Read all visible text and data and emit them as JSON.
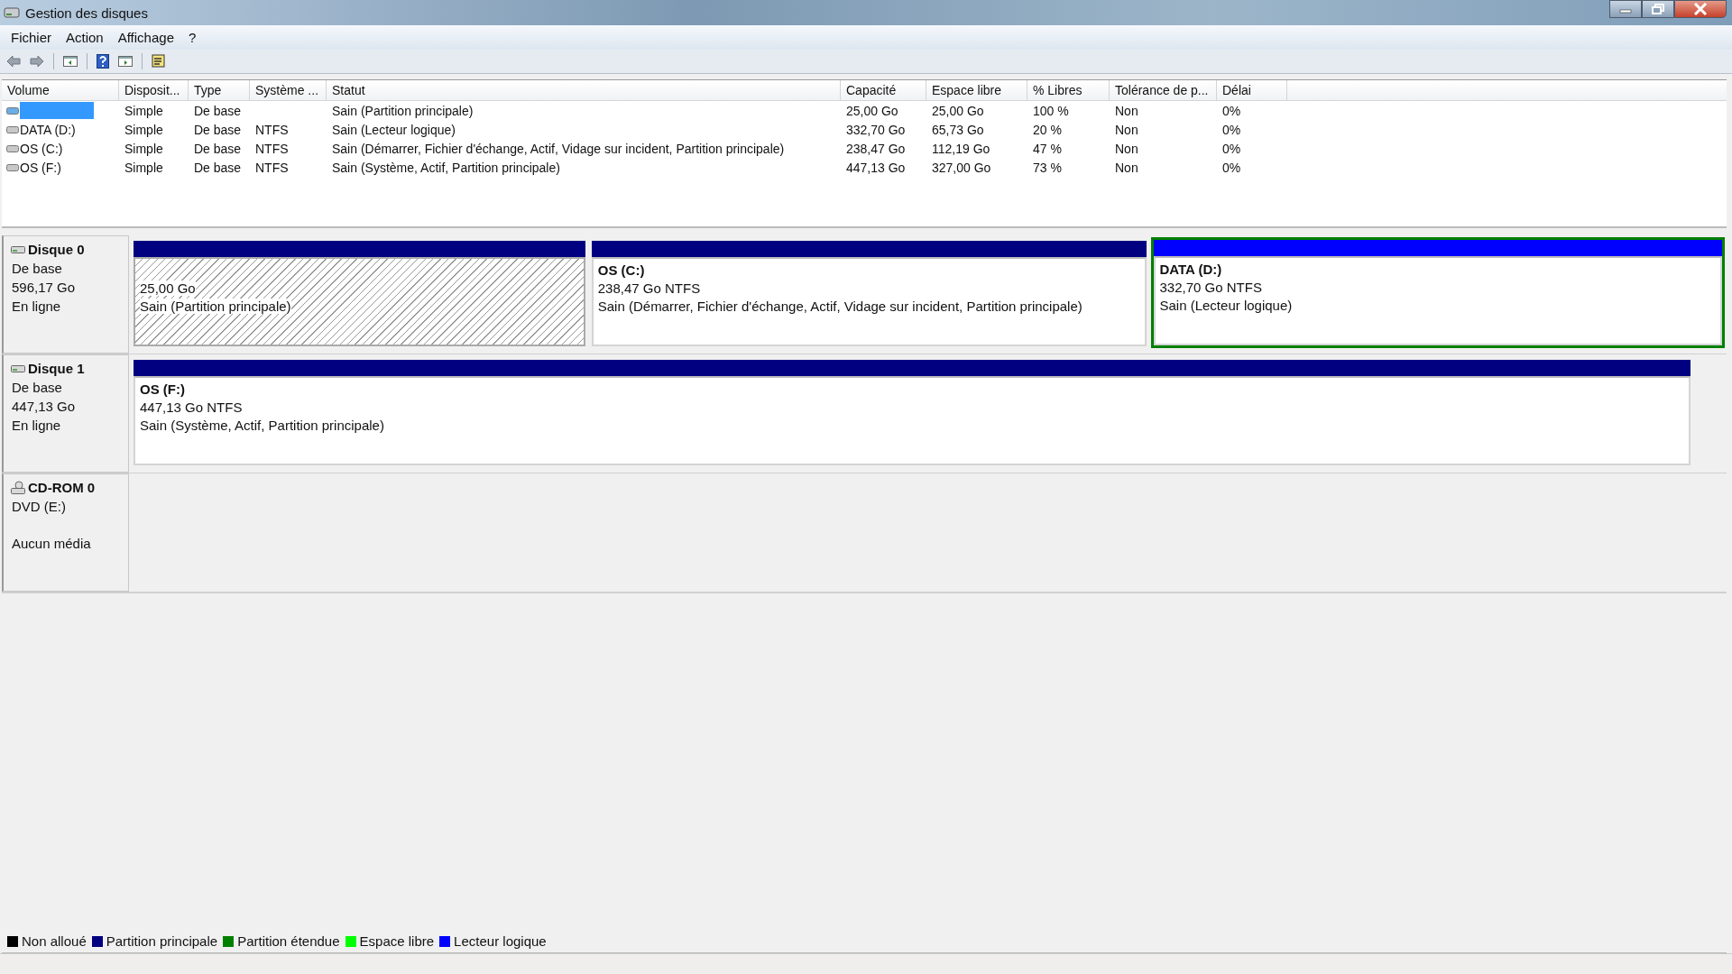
{
  "window": {
    "title": "Gestion des disques"
  },
  "menu": [
    "Fichier",
    "Action",
    "Affichage",
    "?"
  ],
  "table": {
    "columns": [
      "Volume",
      "Disposit...",
      "Type",
      "Système ...",
      "Statut",
      "Capacité",
      "Espace libre",
      "% Libres",
      "Tolérance de p...",
      "Délai"
    ],
    "rows": [
      {
        "selected": true,
        "cells": [
          "",
          "Simple",
          "De base",
          "",
          "Sain (Partition principale)",
          "25,00 Go",
          "25,00 Go",
          "100 %",
          "Non",
          "0%"
        ]
      },
      {
        "selected": false,
        "cells": [
          "DATA (D:)",
          "Simple",
          "De base",
          "NTFS",
          "Sain (Lecteur logique)",
          "332,70 Go",
          "65,73 Go",
          "20 %",
          "Non",
          "0%"
        ]
      },
      {
        "selected": false,
        "cells": [
          "OS (C:)",
          "Simple",
          "De base",
          "NTFS",
          "Sain (Démarrer, Fichier d'échange, Actif, Vidage sur incident, Partition principale)",
          "238,47 Go",
          "112,19 Go",
          "47 %",
          "Non",
          "0%"
        ]
      },
      {
        "selected": false,
        "cells": [
          "OS (F:)",
          "Simple",
          "De base",
          "NTFS",
          "Sain (Système, Actif, Partition principale)",
          "447,13 Go",
          "327,00 Go",
          "73 %",
          "Non",
          "0%"
        ]
      }
    ]
  },
  "disks": [
    {
      "kind": "disk",
      "name": "Disque 0",
      "type": "De base",
      "size": "596,17 Go",
      "state": "En ligne",
      "partitions": [
        {
          "kind": "primary",
          "selected": true,
          "size": "25,00 Go",
          "status": "Sain (Partition principale)"
        },
        {
          "kind": "primary",
          "selected": false,
          "name": "OS  (C:)",
          "size": "238,47 Go NTFS",
          "status": "Sain (Démarrer, Fichier d'échange, Actif, Vidage sur incident, Partition principale)"
        },
        {
          "kind": "logical",
          "selected": false,
          "name": "DATA  (D:)",
          "size": "332,70 Go NTFS",
          "status": "Sain (Lecteur logique)"
        }
      ]
    },
    {
      "kind": "disk",
      "name": "Disque 1",
      "type": "De base",
      "size": "447,13 Go",
      "state": "En ligne",
      "partitions": [
        {
          "kind": "primary",
          "selected": false,
          "name": "OS  (F:)",
          "size": "447,13 Go NTFS",
          "status": "Sain (Système, Actif, Partition principale)"
        }
      ]
    },
    {
      "kind": "cdrom",
      "name": "CD-ROM 0",
      "type": "DVD (E:)",
      "state": "Aucun média"
    }
  ],
  "legend": [
    {
      "label": "Non alloué",
      "color": "#000000"
    },
    {
      "label": "Partition principale",
      "color": "#000080"
    },
    {
      "label": "Partition étendue",
      "color": "#008000"
    },
    {
      "label": "Espace libre",
      "color": "#00ff00"
    },
    {
      "label": "Lecteur logique",
      "color": "#0000ff"
    }
  ]
}
